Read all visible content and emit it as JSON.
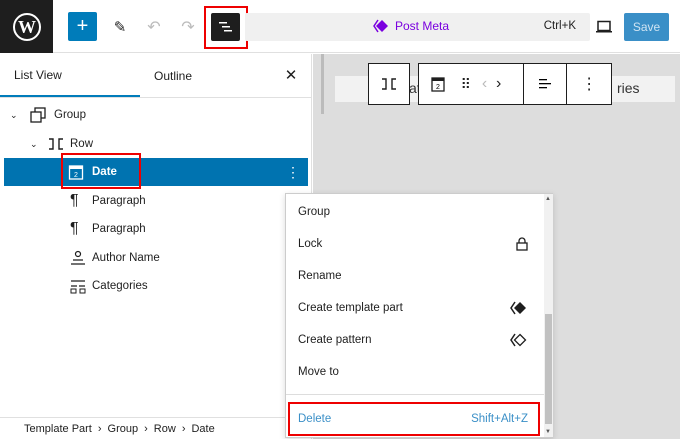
{
  "topbar": {
    "command_label": "Post Meta",
    "shortcut": "Ctrl+K",
    "save_label": "Save",
    "accent": "#007cba",
    "purple": "#7a00df"
  },
  "sidebar": {
    "tabs": [
      {
        "label": "List View"
      },
      {
        "label": "Outline"
      }
    ],
    "items": [
      {
        "label": "Group",
        "icon": "group-icon"
      },
      {
        "label": "Row",
        "icon": "row-icon"
      },
      {
        "label": "Date",
        "icon": "calendar-icon",
        "selected": true
      },
      {
        "label": "Paragraph",
        "icon": "paragraph-icon"
      },
      {
        "label": "Paragraph",
        "icon": "paragraph-icon"
      },
      {
        "label": "Author Name",
        "icon": "author-icon"
      },
      {
        "label": "Categories",
        "icon": "categories-icon"
      }
    ]
  },
  "canvas": {
    "fragment_left": "at",
    "fragment_right": "ries"
  },
  "menu": {
    "items": [
      {
        "label": "Group"
      },
      {
        "label": "Lock"
      },
      {
        "label": "Rename"
      },
      {
        "label": "Create template part"
      },
      {
        "label": "Create pattern"
      },
      {
        "label": "Move to"
      }
    ],
    "delete_label": "Delete",
    "delete_shortcut": "Shift+Alt+Z"
  },
  "breadcrumb": [
    "Template Part",
    "Group",
    "Row",
    "Date"
  ]
}
